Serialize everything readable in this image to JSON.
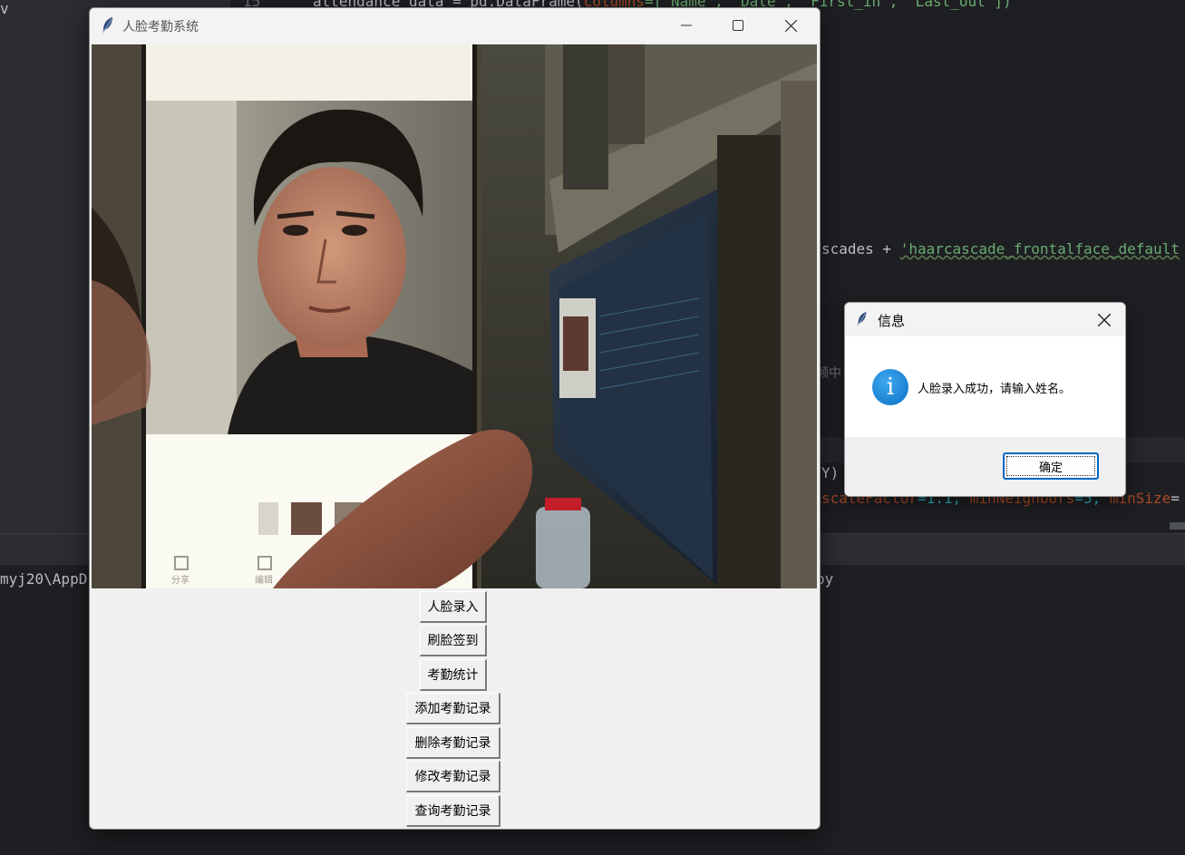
{
  "ide": {
    "code_top_1": "attendance_data = pd.DataFrame(",
    "code_top_kw": "columns",
    "code_top_2": "=['Name', 'Date', 'First_in', 'Last_out'])",
    "code_line_num": "15",
    "code_cascade_1": "scades + ",
    "code_cascade_str": "'haarcascade_frontalface_default",
    "code_chinese": "频中",
    "code_y": "Y)",
    "code_detect_1": "scaleFactor",
    "code_detect_2": "=1.1, ",
    "code_detect_3": "minNeighbors",
    "code_detect_4": "=5, ",
    "code_detect_5": "minSize",
    "code_detect_6": "=",
    "code_left_v": "v",
    "terminal_path": "myj20\\AppD",
    "terminal_py": "py"
  },
  "app": {
    "title": "人脸考勤系统",
    "buttons": [
      "人脸录入",
      "刷脸签到",
      "考勤统计",
      "添加考勤记录",
      "删除考勤记录",
      "修改考勤记录",
      "查询考勤记录"
    ],
    "camera_ui": {
      "share_label": "分享",
      "edit_label": "编辑"
    }
  },
  "dialog": {
    "title": "信息",
    "message": "人脸录入成功，请输入姓名。",
    "ok_label": "确定",
    "icon": "info-icon"
  },
  "colors": {
    "accent": "#0067c0",
    "info_icon": "#0a78d0",
    "ide_bg": "#1e1f22"
  }
}
